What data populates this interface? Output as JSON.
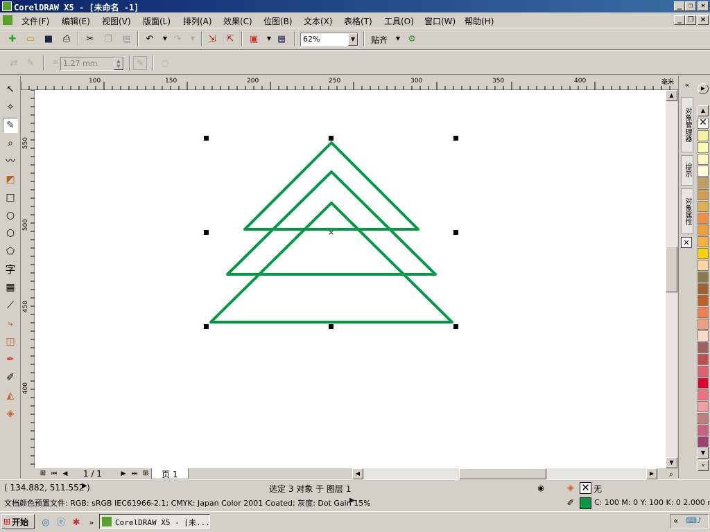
{
  "window": {
    "title": "CorelDRAW X5 - [未命名 -1]"
  },
  "menu": {
    "items": [
      "文件(F)",
      "编辑(E)",
      "视图(V)",
      "版面(L)",
      "排列(A)",
      "效果(C)",
      "位图(B)",
      "文本(X)",
      "表格(T)",
      "工具(O)",
      "窗口(W)",
      "帮助(H)"
    ]
  },
  "toolbar": {
    "zoom_value": "62%",
    "snap_label": "贴齐"
  },
  "propbar": {
    "outline_width": "1.27 mm"
  },
  "rulers": {
    "h_ticks": [
      "100",
      "150",
      "200",
      "250",
      "300",
      "350",
      "400"
    ],
    "h_unit": "毫米",
    "v_ticks": [
      "550",
      "500",
      "450",
      "400"
    ]
  },
  "page_nav": {
    "counter": "1 / 1",
    "tab": "页 1"
  },
  "dockers": {
    "tabs": [
      "对象管理器",
      "提示",
      "对象属性"
    ]
  },
  "palette": {
    "colors": [
      "#f5f0a0",
      "#fafab0",
      "#fff8c0",
      "#fffce0",
      "#c0a060",
      "#d0a050",
      "#e0b050",
      "#f09040",
      "#f0a030",
      "#f8b040",
      "#ffd000",
      "#ffd8a0",
      "#8a7a50",
      "#a06030",
      "#c06020",
      "#f08050",
      "#f0a080",
      "#ffd8c8",
      "#a06060",
      "#c05050",
      "#e06070",
      "#e00030",
      "#f07080",
      "#f0a0a0",
      "#c08080",
      "#d06080",
      "#a04070"
    ]
  },
  "status": {
    "coords": "( 134.882, 511.552 )",
    "selection": "选定 3 对象 于 图层 1",
    "fill_label": "无",
    "color_profile": "文档颜色预置文件: RGB: sRGB IEC61966-2.1; CMYK: Japan Color 2001 Coated; 灰度: Dot Gain 15%",
    "outline": "C: 100 M: 0 Y: 100 K: 0  2.000 mm",
    "outline_color": "#009a44"
  },
  "taskbar": {
    "start": "开始",
    "task": "CorelDRAW X5 - [未..."
  }
}
